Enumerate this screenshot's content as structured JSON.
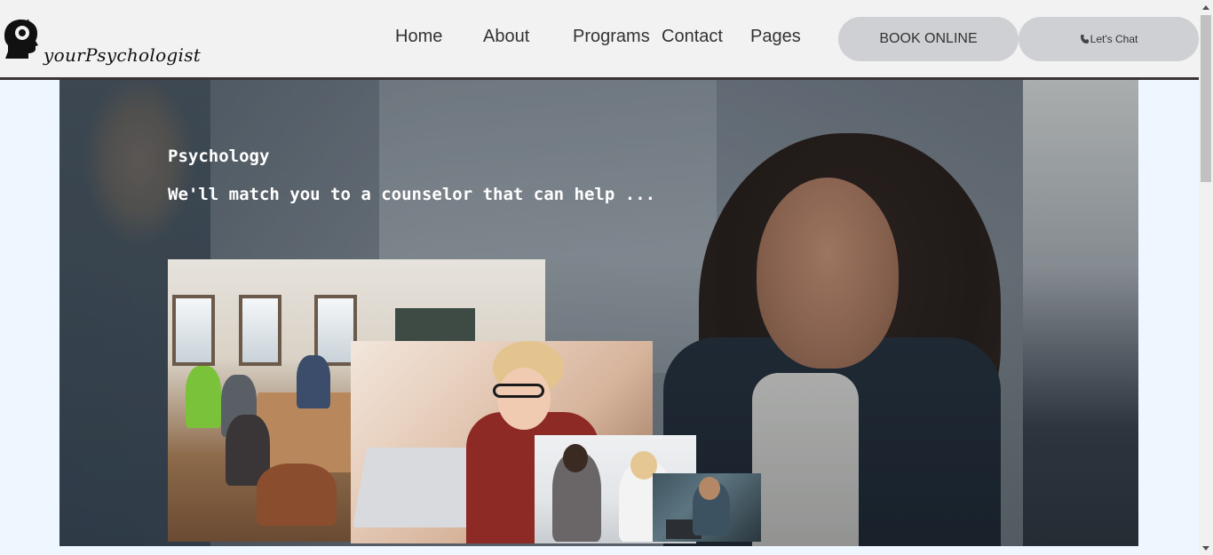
{
  "brand": {
    "name": "yourPsychologist"
  },
  "nav": {
    "items": [
      {
        "label": "Home"
      },
      {
        "label": "About"
      },
      {
        "label": "Programs"
      },
      {
        "label": "Contact"
      },
      {
        "label": "Pages"
      }
    ]
  },
  "actions": {
    "book_label": "BOOK ONLINE",
    "chat_label": "Let's Chat",
    "chat_icon": "chat-phone-icon"
  },
  "hero": {
    "subtitle": "Psychology",
    "title": "We'll match you to a counselor that can help ..."
  },
  "colors": {
    "header_bg": "#f2f2f2",
    "header_rule": "#3a3436",
    "button_bg": "#cfd0d4",
    "page_bg": "#eef6ff",
    "hero_text": "#ffffff"
  }
}
